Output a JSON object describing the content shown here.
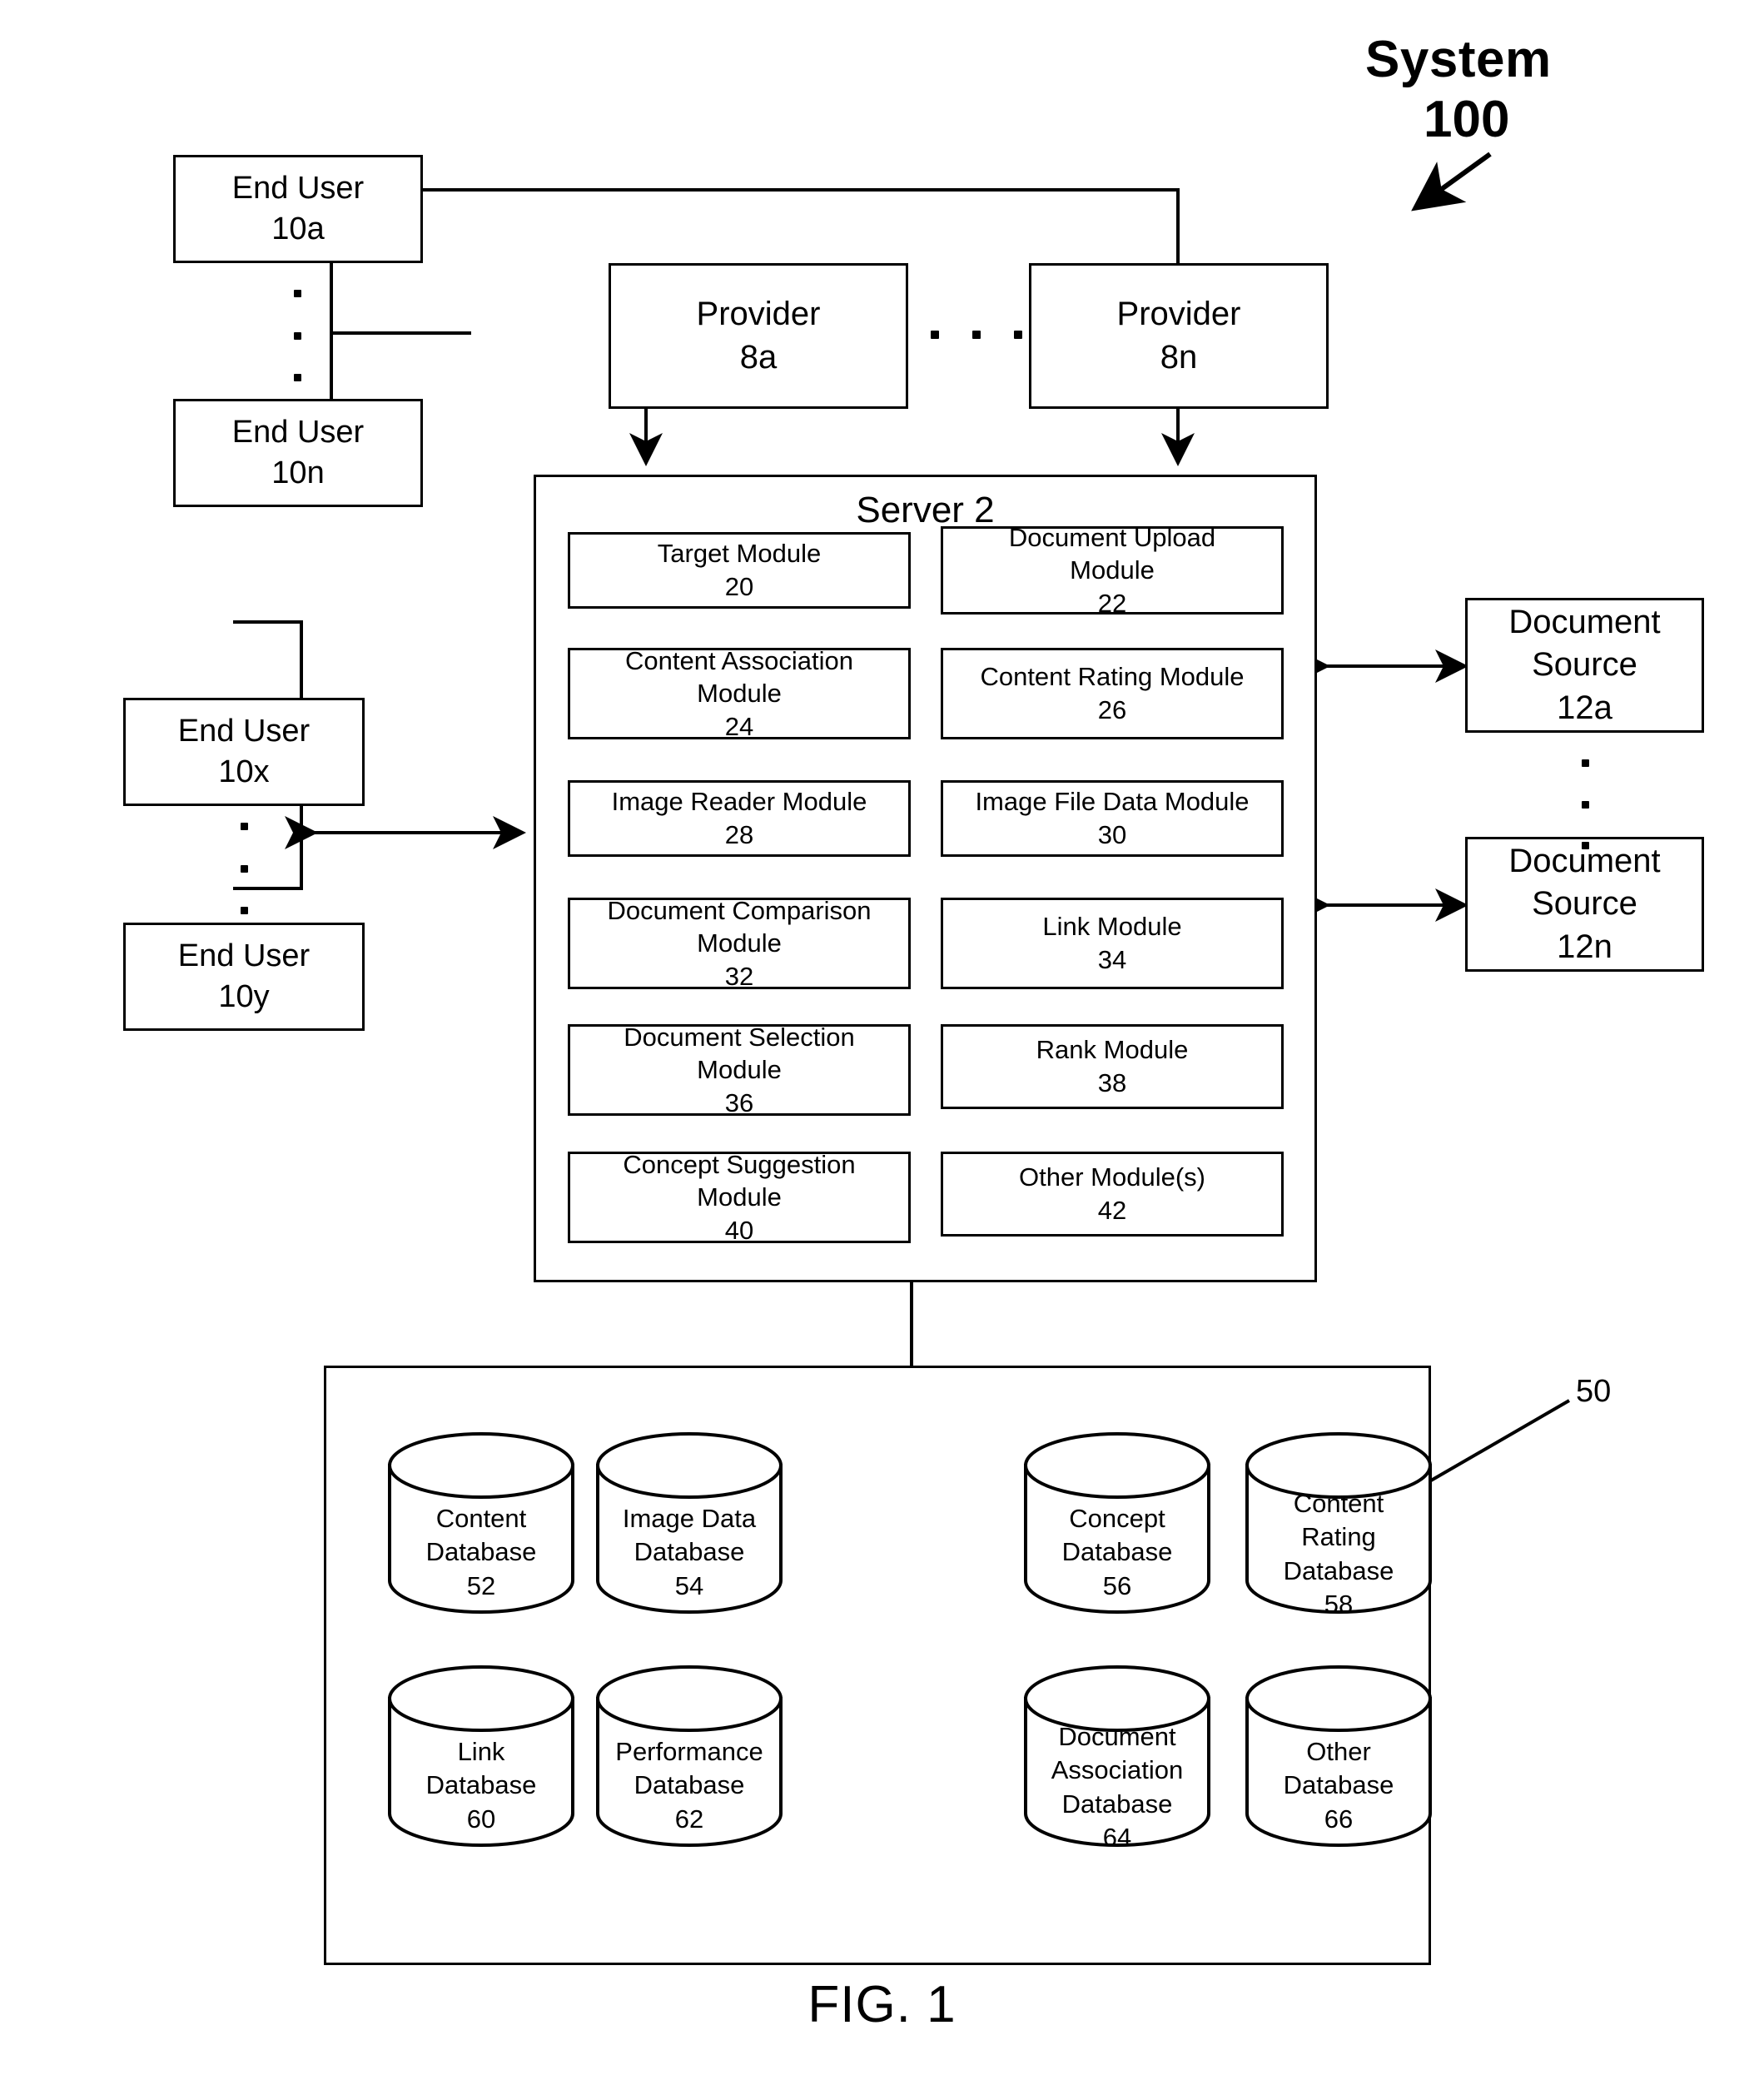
{
  "figure": {
    "caption": "FIG. 1",
    "system_label": "System",
    "system_number": "100",
    "db_group_ref": "50"
  },
  "end_users_top": [
    {
      "name": "End User",
      "ref": "10a"
    },
    {
      "name": "End User",
      "ref": "10n"
    }
  ],
  "end_users_left": [
    {
      "name": "End User",
      "ref": "10x"
    },
    {
      "name": "End User",
      "ref": "10y"
    }
  ],
  "providers": [
    {
      "name": "Provider",
      "ref": "8a"
    },
    {
      "name": "Provider",
      "ref": "8n"
    }
  ],
  "document_sources": [
    {
      "l1": "Document",
      "l2": "Source",
      "ref": "12a"
    },
    {
      "l1": "Document",
      "l2": "Source",
      "ref": "12n"
    }
  ],
  "server": {
    "title": "Server 2",
    "modules_left": [
      {
        "l1": "Target Module",
        "l2": "",
        "ref": "20"
      },
      {
        "l1": "Content Association",
        "l2": "Module",
        "ref": "24"
      },
      {
        "l1": "Image Reader Module",
        "l2": "",
        "ref": "28"
      },
      {
        "l1": "Document Comparison",
        "l2": "Module",
        "ref": "32"
      },
      {
        "l1": "Document Selection",
        "l2": "Module",
        "ref": "36"
      },
      {
        "l1": "Concept Suggestion",
        "l2": "Module",
        "ref": "40"
      }
    ],
    "modules_right": [
      {
        "l1": "Document Upload",
        "l2": "Module",
        "ref": "22"
      },
      {
        "l1": "Content Rating Module",
        "l2": "",
        "ref": "26"
      },
      {
        "l1": "Image File Data Module",
        "l2": "",
        "ref": "30"
      },
      {
        "l1": "Link Module",
        "l2": "",
        "ref": "34"
      },
      {
        "l1": "Rank Module",
        "l2": "",
        "ref": "38"
      },
      {
        "l1": "Other Module(s)",
        "l2": "",
        "ref": "42"
      }
    ]
  },
  "databases_row1": [
    {
      "l1": "Content",
      "l2": "Database",
      "l3": "",
      "ref": "52"
    },
    {
      "l1": "Image Data",
      "l2": "Database",
      "l3": "",
      "ref": "54"
    },
    {
      "l1": "Concept",
      "l2": "Database",
      "l3": "",
      "ref": "56"
    },
    {
      "l1": "Content",
      "l2": "Rating",
      "l3": "Database",
      "ref": "58"
    }
  ],
  "databases_row2": [
    {
      "l1": "Link",
      "l2": "Database",
      "l3": "",
      "ref": "60"
    },
    {
      "l1": "Performance",
      "l2": "Database",
      "l3": "",
      "ref": "62"
    },
    {
      "l1": "Document",
      "l2": "Association",
      "l3": "Database",
      "ref": "64"
    },
    {
      "l1": "Other",
      "l2": "Database",
      "l3": "",
      "ref": "66"
    }
  ],
  "colors": {
    "ink": "#000000",
    "paper": "#ffffff"
  }
}
